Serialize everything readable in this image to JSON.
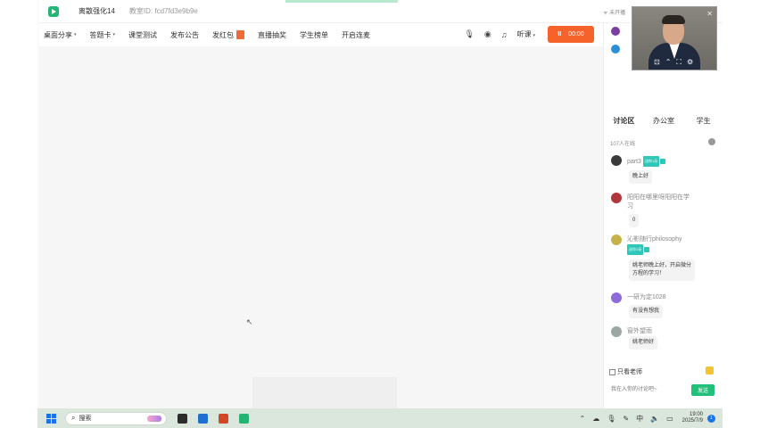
{
  "window": {
    "app_name": "离散强化14",
    "room_label": "教室ID: fcd7fd3e9b9e",
    "net_status": "未开播"
  },
  "toolbar": {
    "items": [
      {
        "label": "桌面分享",
        "caret": "▾"
      },
      {
        "label": "答题卡",
        "caret": "▾"
      },
      {
        "label": "课堂测试"
      },
      {
        "label": "发布公告"
      },
      {
        "label": "发红包"
      },
      {
        "label": "直播抽奖"
      },
      {
        "label": "学生榜单"
      },
      {
        "label": "开启连麦"
      }
    ],
    "listen_label": "听课",
    "listen_caret": "▾",
    "live_pause": "II",
    "live_time": "00:00"
  },
  "panel": {
    "tabs": [
      "讨论区",
      "办公室",
      "学生"
    ],
    "online_count": "107人在线",
    "messages": [
      {
        "name": "part3",
        "tag": "送你1朵",
        "bubble": "晚上好"
      },
      {
        "name": "阳阳在哪里呀阳阳在学",
        "name2": "习",
        "bubble": "0"
      },
      {
        "name": "沁影随行philosophy",
        "tag": "送你1朵",
        "bubble": "姚老师晚上好，开启微分",
        "bubble2": "方程的学习！"
      },
      {
        "name": "一研为定1028",
        "bubble": "有没有想我"
      },
      {
        "name": "窗外望雨",
        "bubble": "姚老师好"
      }
    ],
    "only_teacher": "只看老师",
    "input_placeholder": "我在入你的讨论吧~",
    "send_label": "发送"
  },
  "taskbar": {
    "search_label": "搜索",
    "tray_ime": "中",
    "time": "19:00",
    "date": "2025/7/9",
    "notif_count": "1"
  },
  "colors": {
    "accent_green": "#22c07a",
    "live_orange": "#f5622a",
    "tag_teal": "#2fc7b7"
  }
}
